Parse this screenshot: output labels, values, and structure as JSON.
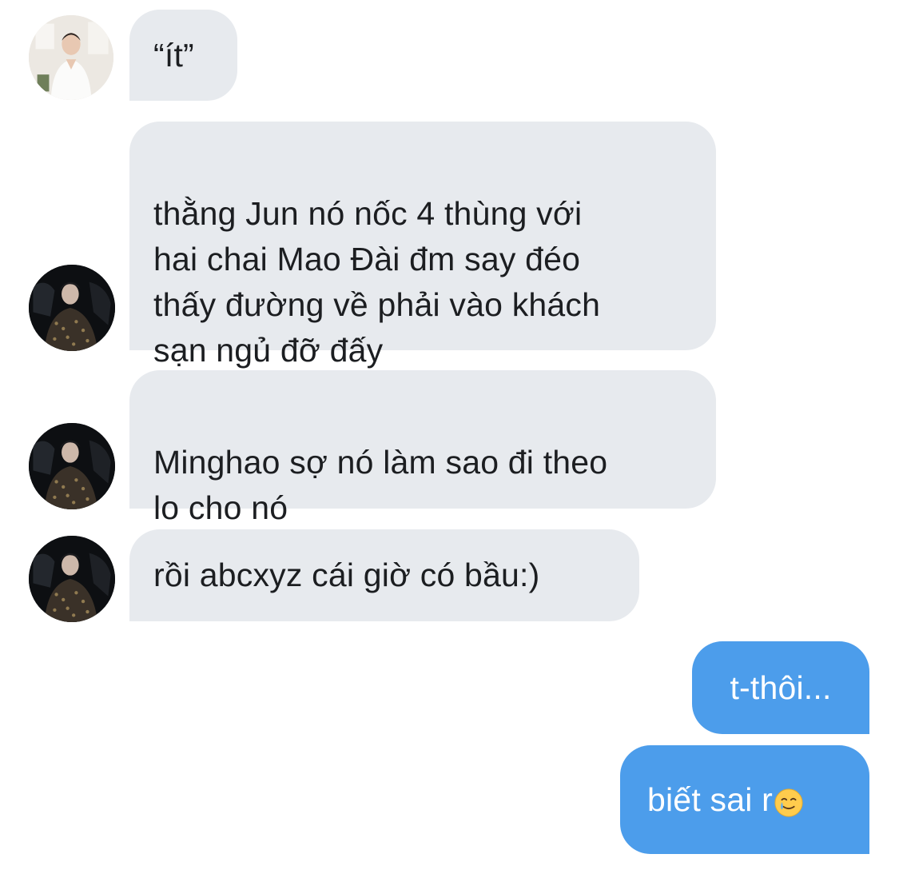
{
  "conversation": {
    "messages": [
      {
        "sender": "other",
        "avatar": "light-avatar",
        "text": "“ít”"
      },
      {
        "sender": "other",
        "avatar": "dark-avatar",
        "text": "thằng Jun nó nốc 4 thùng với\nhai chai Mao Đài đm say đéo\nthấy đường về phải vào khách\nsạn ngủ đỡ đấy"
      },
      {
        "sender": "other",
        "avatar": "dark-avatar",
        "text": "Minghao sợ nó làm sao đi theo\nlo cho nó"
      },
      {
        "sender": "other",
        "avatar": "dark-avatar",
        "text": "rồi abcxyz cái giờ có bầu:)"
      },
      {
        "sender": "me",
        "text": "t-thôi..."
      },
      {
        "sender": "me",
        "text": "biết sai r",
        "emoji": "smiling-face-with-tear-icon"
      }
    ]
  },
  "colors": {
    "incoming_bubble": "#e7eaee",
    "incoming_text": "#1c1e21",
    "outgoing_bubble": "#4c9deb",
    "outgoing_text": "#ffffff",
    "background": "#ffffff"
  }
}
